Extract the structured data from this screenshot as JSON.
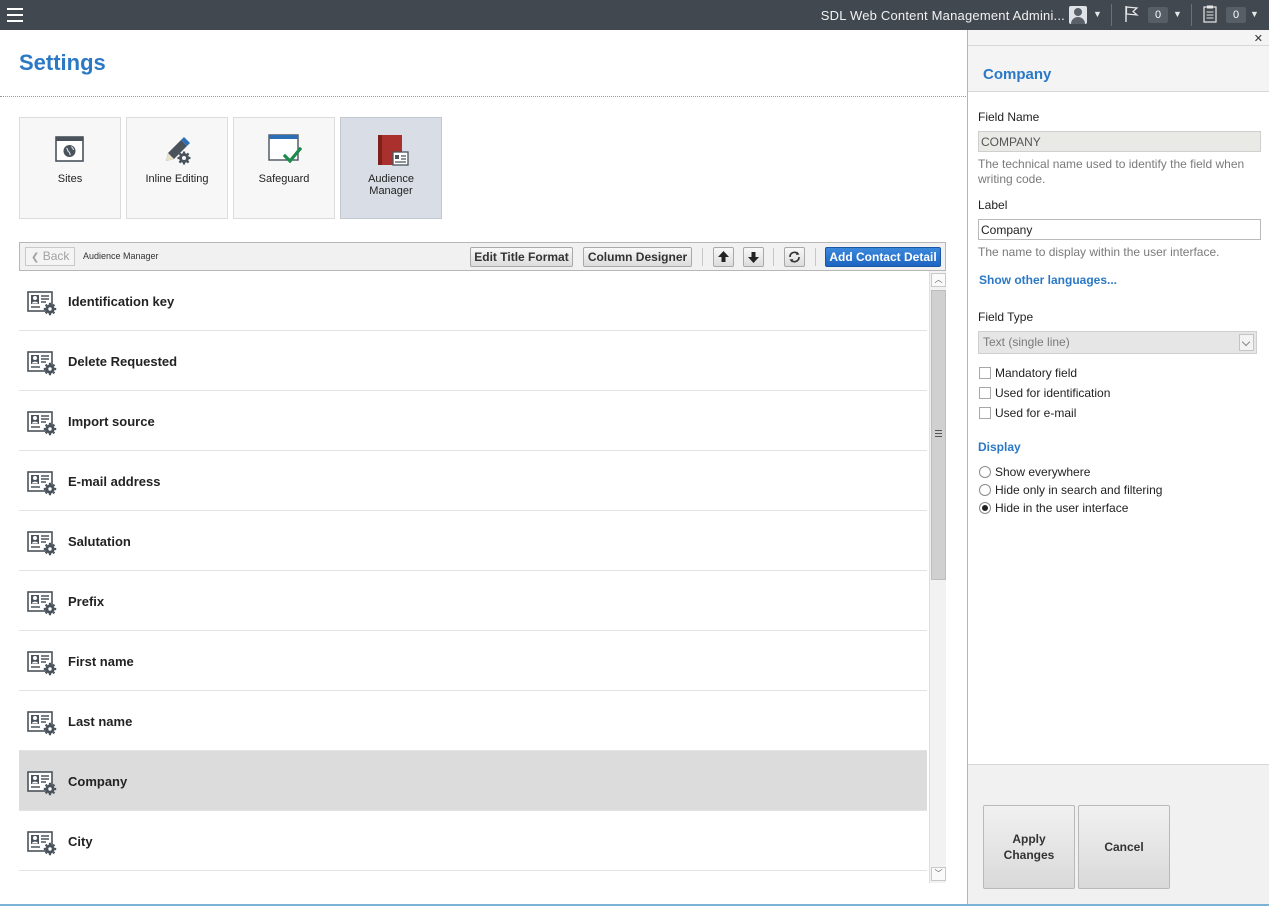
{
  "header": {
    "app_title": "SDL Web Content Management Admini...",
    "notifications_count": "0",
    "tasks_count": "0"
  },
  "page": {
    "title": "Settings"
  },
  "tiles": [
    {
      "label": "Sites",
      "icon": "globe-window-icon"
    },
    {
      "label": "Inline Editing",
      "icon": "pencil-gear-icon"
    },
    {
      "label": "Safeguard",
      "icon": "window-check-icon"
    },
    {
      "label": "Audience Manager",
      "icon": "book-contact-icon",
      "active": true
    }
  ],
  "toolbar": {
    "back_label": "Back",
    "breadcrumb": "Audience Manager",
    "edit_title_format": "Edit Title Format",
    "column_designer": "Column Designer",
    "add_contact_detail": "Add Contact Detail"
  },
  "list": {
    "items": [
      {
        "label": "Identification key"
      },
      {
        "label": "Delete Requested"
      },
      {
        "label": "Import source"
      },
      {
        "label": "E-mail address"
      },
      {
        "label": "Salutation"
      },
      {
        "label": "Prefix"
      },
      {
        "label": "First name"
      },
      {
        "label": "Last name"
      },
      {
        "label": "Company",
        "selected": true
      },
      {
        "label": "City"
      }
    ]
  },
  "panel": {
    "title": "Company",
    "field_name_label": "Field Name",
    "field_name_value": "COMPANY",
    "field_name_help": "The technical name used to identify the field when writing code.",
    "label_label": "Label",
    "label_value": "Company",
    "label_help": "The name to display within the user interface.",
    "show_other_languages": "Show other languages...",
    "field_type_label": "Field Type",
    "field_type_value": "Text (single line)",
    "mandatory_field": "Mandatory field",
    "used_for_identification": "Used for identification",
    "used_for_email": "Used for e-mail",
    "display_title": "Display",
    "display_options": [
      {
        "label": "Show everywhere",
        "checked": false
      },
      {
        "label": "Hide only in search and filtering",
        "checked": false
      },
      {
        "label": "Hide in the user interface",
        "checked": true
      }
    ],
    "apply_label": "Apply Changes",
    "cancel_label": "Cancel"
  },
  "colors": {
    "accent": "#2b78c5",
    "topbar": "#41484f",
    "primary_button": "#1d64c0",
    "selected_row": "#dcdcdc",
    "audience_icon": "#a9302c"
  }
}
